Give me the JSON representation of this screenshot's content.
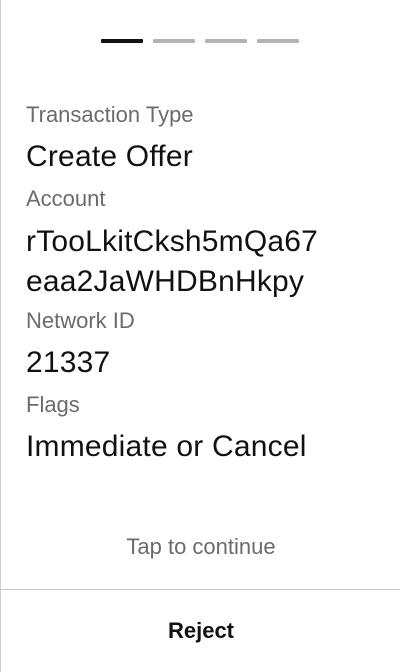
{
  "pager": {
    "total_steps": 4,
    "active_step": 1
  },
  "fields": [
    {
      "label": "Transaction Type",
      "value": "Create Offer"
    },
    {
      "label": "Account",
      "value": "rTooLkitCksh5mQa67\neaa2JaWHDBnHkpy"
    },
    {
      "label": "Network ID",
      "value": "21337"
    },
    {
      "label": "Flags",
      "value": "Immediate or Cancel"
    }
  ],
  "hint": "Tap to continue",
  "actions": {
    "reject_label": "Reject"
  }
}
